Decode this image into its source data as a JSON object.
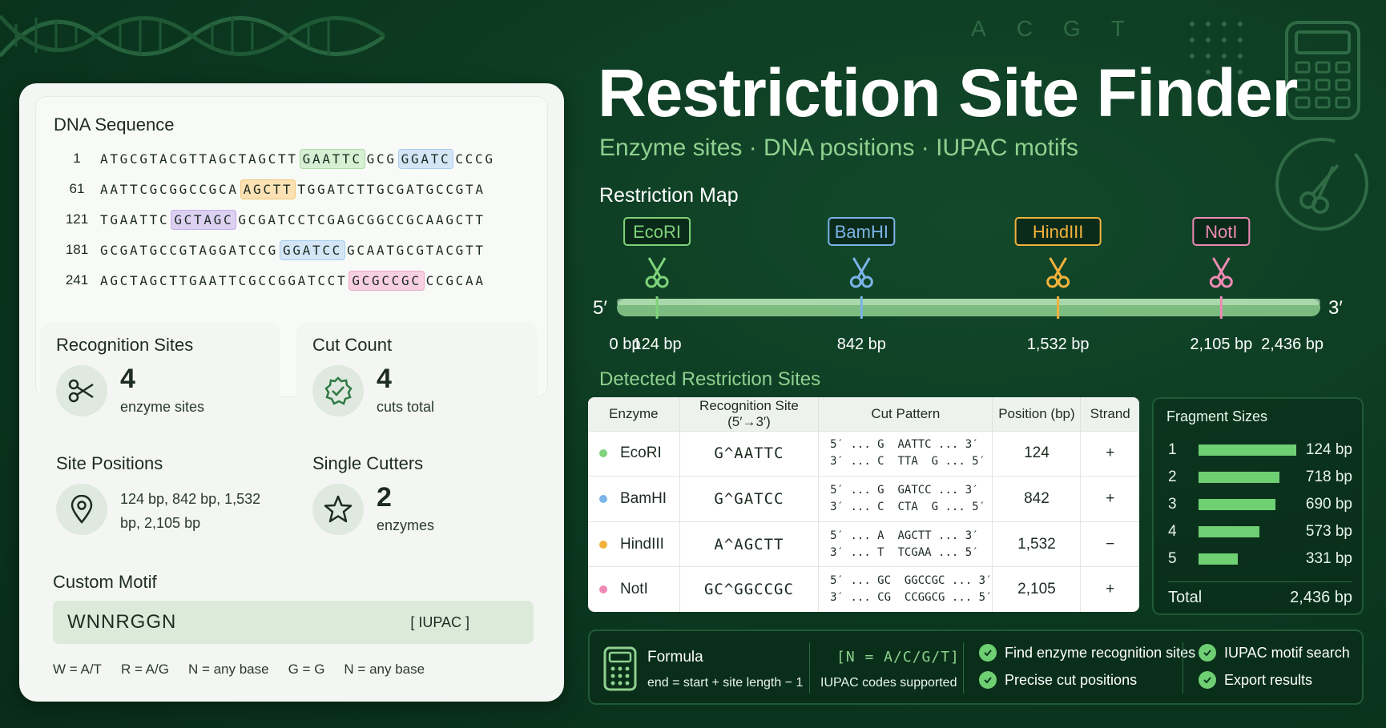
{
  "header": {
    "title": "Restriction Site Finder",
    "subtitle": "Enzyme sites · DNA positions · IUPAC motifs",
    "deco_letters": [
      "A",
      "C",
      "G",
      "T"
    ]
  },
  "dna": {
    "title": "DNA Sequence",
    "rows": [
      {
        "num": "1",
        "pre": "ATGCGTACGTTAGCTAGCTT",
        "hl": "GAATTC",
        "mid": "GCG",
        "hl2": "GGATC",
        "post": "CCCG"
      },
      {
        "num": "61",
        "pre": "AATTCGCGGCCGCA",
        "hl": "AGCTT",
        "post": "TGGATCTTGCGATGCCGTA"
      },
      {
        "num": "121",
        "pre": "TGAATTC",
        "hl": "GCTAGC",
        "post": "GCGATCCTCGAGCGGCCGCAAGCTT"
      },
      {
        "num": "181",
        "pre": "GCGATGCCGTAGGATCCG",
        "hl": "GGATCC",
        "post": "GCAATGCGTACGTT"
      },
      {
        "num": "241",
        "pre": "AGCTAGCTTGAATTCGCCGGATCCT",
        "hl": "GCGCCGC",
        "post": "CCGCAA"
      }
    ]
  },
  "stats": {
    "recognition": {
      "title": "Recognition Sites",
      "value": "4",
      "sub": "enzyme sites"
    },
    "cut_count": {
      "title": "Cut Count",
      "value": "4",
      "sub": "cuts total"
    },
    "positions": {
      "title": "Site Positions",
      "text": "124 bp, 842 bp, 1,532 bp, 2,105 bp"
    },
    "single": {
      "title": "Single Cutters",
      "value": "2",
      "sub": "enzymes"
    }
  },
  "motif": {
    "title": "Custom Motif",
    "value": "WNNRGGN",
    "tag": "[ IUPAC ]",
    "legend": [
      "W = A/T",
      "R = A/G",
      "N = any base",
      "G = G",
      "N = any base"
    ]
  },
  "map": {
    "title": "Restriction Map",
    "five": "5′",
    "three": "3′",
    "total_bp": 2436,
    "enzymes": [
      {
        "name": "EcoRI",
        "pos": 124,
        "color": "#7fd37a",
        "label_pos": 124,
        "label_x_bp": 124
      },
      {
        "name": "BamHI",
        "pos": 842,
        "color": "#7bb4e8"
      },
      {
        "name": "HindIII",
        "pos": 1532,
        "color": "#f2b13b"
      },
      {
        "name": "NotI",
        "pos": 2105,
        "color": "#ee8ab4"
      }
    ],
    "ticks": [
      "0 bp",
      "124 bp",
      "842 bp",
      "1,532 bp",
      "2,105 bp",
      "2,436 bp"
    ]
  },
  "detected": {
    "title": "Detected Restriction Sites",
    "columns": [
      "Enzyme",
      "Recognition Site (5′→3′)",
      "Cut Pattern",
      "Position (bp)",
      "Strand"
    ],
    "rows": [
      {
        "enzyme": "EcoRI",
        "color": "#7fd37a",
        "site": "G^AATTC",
        "cut1": "5′ ... G  AATTC ... 3′",
        "cut2": "3′ ... C  TTA  G ... 5′",
        "position": "124",
        "strand": "+"
      },
      {
        "enzyme": "BamHI",
        "color": "#7bb4e8",
        "site": "G^GATCC",
        "cut1": "5′ ... G  GATCC ... 3′",
        "cut2": "3′ ... C  CTA  G ... 5′",
        "position": "842",
        "strand": "+"
      },
      {
        "enzyme": "HindIII",
        "color": "#f2b13b",
        "site": "A^AGCTT",
        "cut1": "5′ ... A  AGCTT ... 3′",
        "cut2": "3′ ... T  TCGAA ... 5′",
        "position": "1,532",
        "strand": "−"
      },
      {
        "enzyme": "NotI",
        "color": "#ee8ab4",
        "site": "GC^GGCCGC",
        "cut1": "5′ ... GC  GGCCGC ... 3′",
        "cut2": "3′ ... CG  CCGGCG ... 5′",
        "position": "2,105",
        "strand": "+"
      }
    ]
  },
  "fragments": {
    "title": "Fragment Sizes",
    "rows": [
      {
        "n": "1",
        "label": "124 bp",
        "fraction": 1.0
      },
      {
        "n": "2",
        "label": "718 bp",
        "fraction": 0.83
      },
      {
        "n": "3",
        "label": "690 bp",
        "fraction": 0.79
      },
      {
        "n": "4",
        "label": "573 bp",
        "fraction": 0.62
      },
      {
        "n": "5",
        "label": "331 bp",
        "fraction": 0.4
      }
    ],
    "total_label": "Total",
    "total_value": "2,436 bp"
  },
  "footer": {
    "formula_label": "Formula",
    "formula": "end = start + site length − 1",
    "iupac_code": "[N = A/C/G/T]",
    "iupac_sub": "IUPAC codes supported",
    "features": [
      "Find enzyme recognition sites",
      "Precise cut positions",
      "IUPAC motif search",
      "Export results"
    ]
  },
  "colors": {
    "accent": "#8fd18f",
    "bg": "#0c3a21",
    "bar": "#6fcf73"
  }
}
